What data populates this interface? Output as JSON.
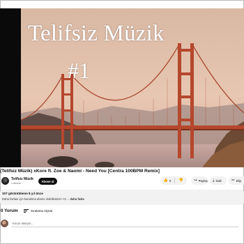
{
  "video": {
    "overlay_title": "Telifsiz Müzik",
    "overlay_number": "#1",
    "title": "(Telifsiz Müzik) xKore ft. Zoe & Naomi - Need You [Centra 100BPM Remix]"
  },
  "channel": {
    "name": "Telifsiz Müzik",
    "subscribers": "1 abone",
    "subscribe_label": "Abone ol"
  },
  "actions": {
    "like_count": "0",
    "share_label": "Paylaş",
    "download_label": "İndir",
    "clip_label": "Klip"
  },
  "description": {
    "stats": "107 görüntüleme  8 yıl önce",
    "text": "Daha fazlası için kanalıma abone olabilirsiniz!! <3 ...",
    "more_label": "daha fazla"
  },
  "comments": {
    "count_label": "0 Yorum",
    "sort_label": "Sıralama ölçütü",
    "input_placeholder": "Yorum ekleyin..."
  },
  "colors": {
    "sky_top": "#d7b5a0",
    "bridge": "#b5472c",
    "subscribe_bg": "#0f0f0f"
  }
}
